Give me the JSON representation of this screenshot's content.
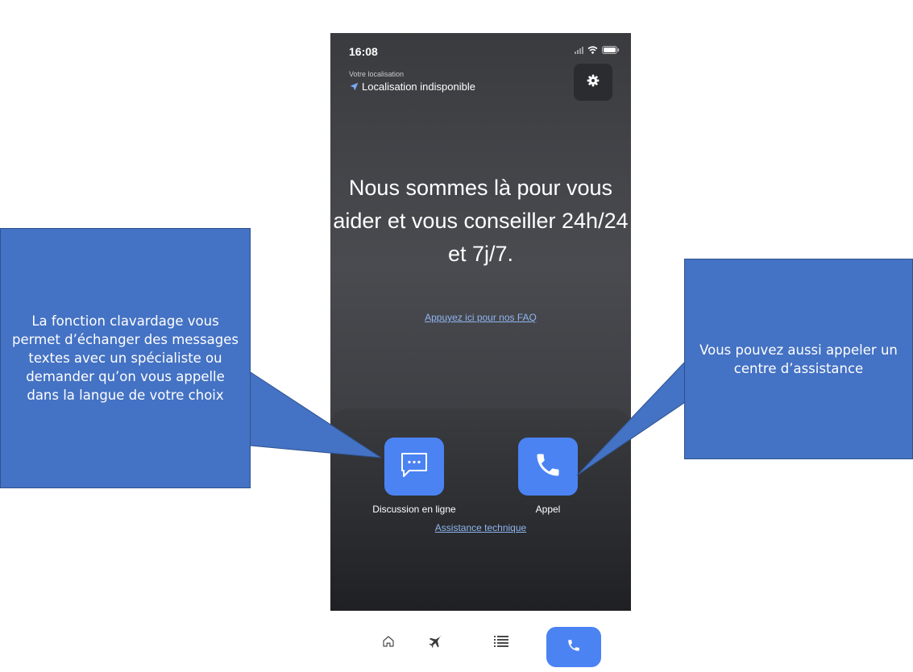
{
  "status_bar": {
    "time": "16:08"
  },
  "header": {
    "location_label": "Votre localisation",
    "location_value": "Localisation indisponible"
  },
  "main": {
    "headline": "Nous sommes là pour vous aider et vous conseiller 24h/24 et 7j/7.",
    "faq_link": "Appuyez ici pour nos FAQ"
  },
  "actions": {
    "chat_label": "Discussion en ligne",
    "call_label": "Appel",
    "tech_support_link": "Assistance technique"
  },
  "tabbar": {
    "items": [
      {
        "icon": "home-icon"
      },
      {
        "icon": "plane-icon"
      },
      {
        "icon": "list-icon"
      },
      {
        "icon": "phone-icon",
        "active": true
      }
    ]
  },
  "annotations": {
    "left": "La fonction clavardage vous permet d’échanger des messages textes avec un spécialiste ou demander qu’on vous appelle dans la langue de votre choix",
    "right": "Vous pouvez aussi appeler un centre d’assistance"
  },
  "colors": {
    "accent": "#4b83f3",
    "callout": "#4472c4",
    "link": "#8fb6f0"
  }
}
